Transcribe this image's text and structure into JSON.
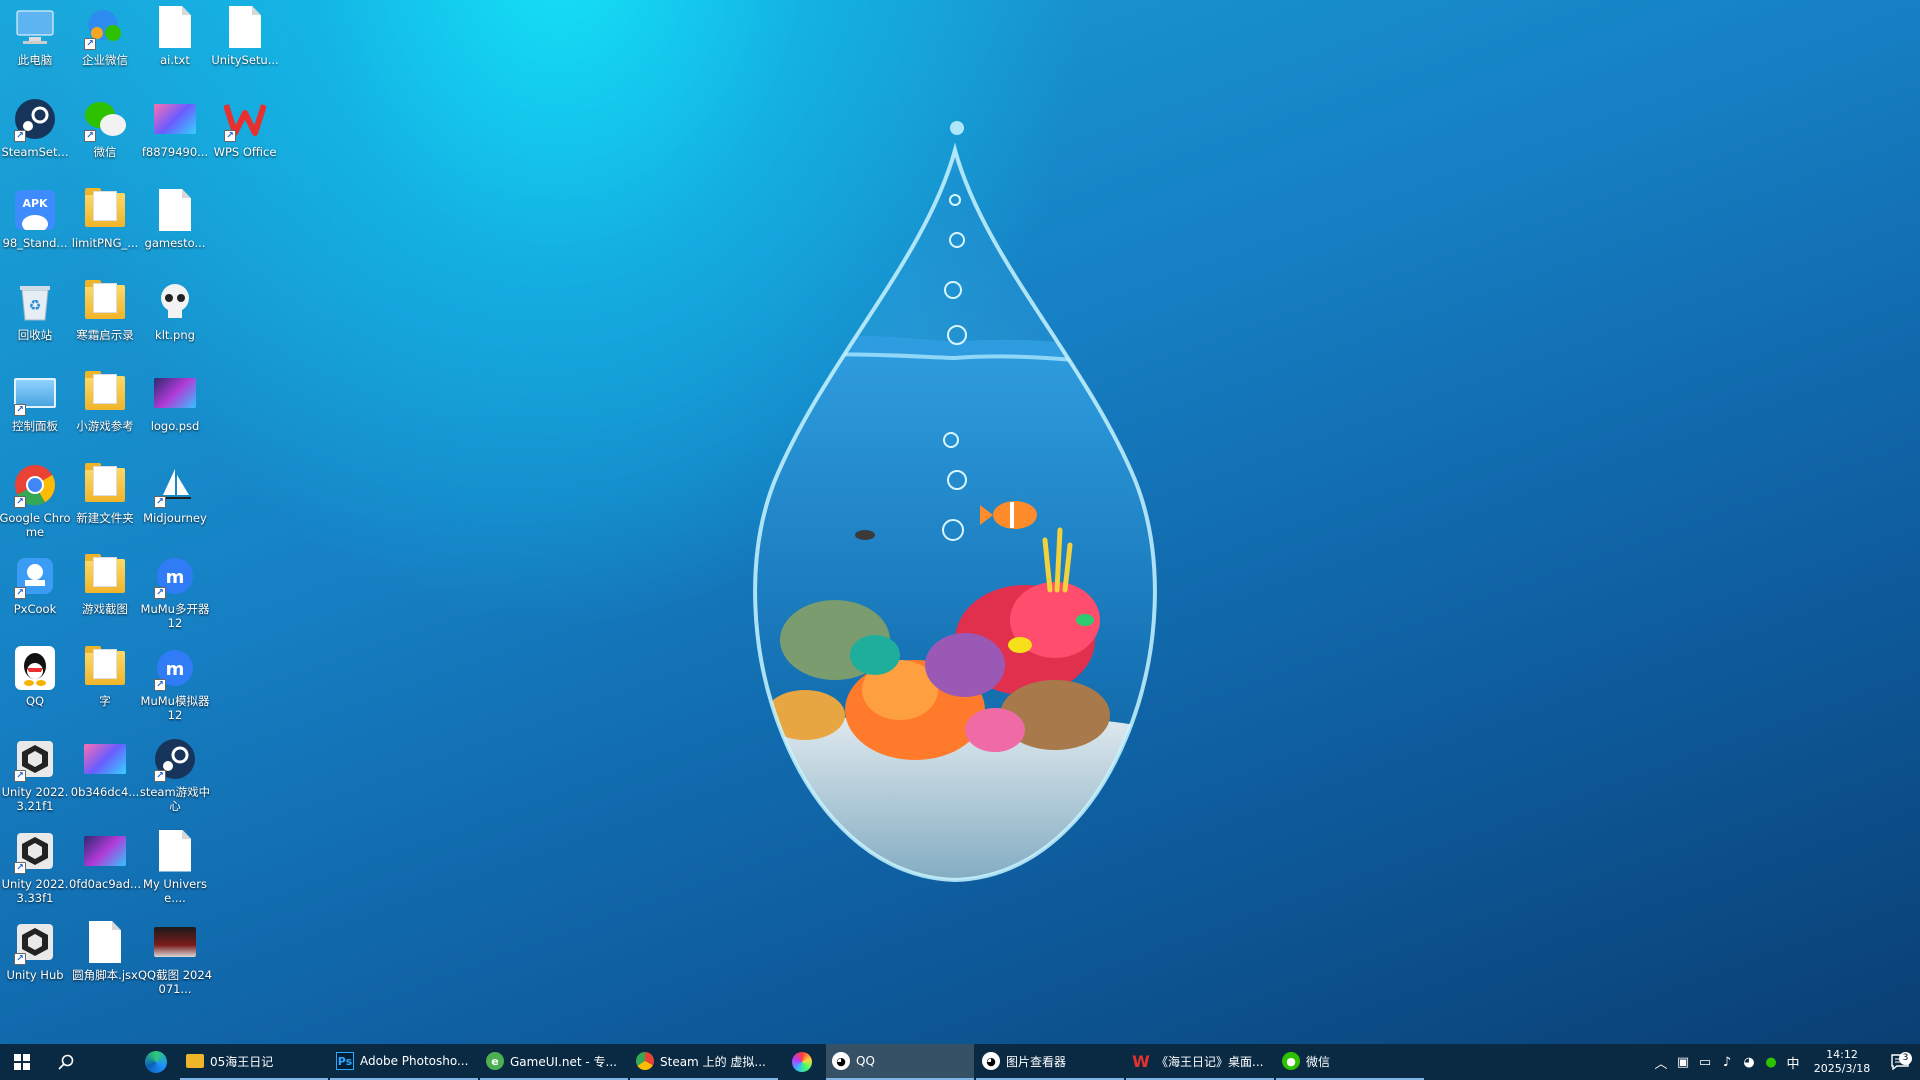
{
  "desktop": {
    "icons": [
      {
        "label": "此电脑",
        "icon": "computer-icon"
      },
      {
        "label": "企业微信",
        "icon": "wecom-icon"
      },
      {
        "label": "ai.txt",
        "icon": "text-file-icon"
      },
      {
        "label": "UnitySetu...",
        "icon": "file-icon"
      },
      {
        "label": "SteamSet...",
        "icon": "steam-icon"
      },
      {
        "label": "微信",
        "icon": "wechat-icon"
      },
      {
        "label": "f8879490...",
        "icon": "image-thumbnail-icon"
      },
      {
        "label": "WPS Office",
        "icon": "wps-icon"
      },
      {
        "label": "98_Stand...",
        "icon": "apk-icon"
      },
      {
        "label": "limitPNG_...",
        "icon": "folder-icon"
      },
      {
        "label": "gamesto...",
        "icon": "file-icon"
      },
      {
        "label": "回收站",
        "icon": "recycle-bin-icon"
      },
      {
        "label": "寒霜启示录",
        "icon": "folder-icon"
      },
      {
        "label": "klt.png",
        "icon": "skull-image-icon"
      },
      {
        "label": "控制面板",
        "icon": "control-panel-icon"
      },
      {
        "label": "小游戏参考",
        "icon": "folder-icon"
      },
      {
        "label": "logo.psd",
        "icon": "psd-thumbnail-icon"
      },
      {
        "label": "Google Chrome",
        "icon": "chrome-icon"
      },
      {
        "label": "新建文件夹",
        "icon": "folder-icon"
      },
      {
        "label": "Midjourney",
        "icon": "midjourney-icon"
      },
      {
        "label": "PxCook",
        "icon": "pxcook-icon"
      },
      {
        "label": "游戏截图",
        "icon": "folder-icon"
      },
      {
        "label": "MuMu多开器12",
        "icon": "mumu-icon"
      },
      {
        "label": "QQ",
        "icon": "qq-icon"
      },
      {
        "label": "字",
        "icon": "folder-icon"
      },
      {
        "label": "MuMu模拟器12",
        "icon": "mumu-icon"
      },
      {
        "label": "Unity 2022.3.21f1",
        "icon": "unity-icon"
      },
      {
        "label": "0b346dc4...",
        "icon": "image-thumbnail-icon"
      },
      {
        "label": "steam游戏中心",
        "icon": "steam-icon"
      },
      {
        "label": "Unity 2022.3.33f1",
        "icon": "unity-icon"
      },
      {
        "label": "0fd0ac9ad...",
        "icon": "psd-thumbnail-icon"
      },
      {
        "label": "My Universe....",
        "icon": "file-icon"
      },
      {
        "label": "Unity Hub",
        "icon": "unity-icon"
      },
      {
        "label": "圆角脚本.jsx",
        "icon": "file-icon"
      },
      {
        "label": "QQ截图 2024071...",
        "icon": "screenshot-thumbnail-icon"
      }
    ]
  },
  "taskbar": {
    "start_icon": "windows-start-icon",
    "search_icon": "search-icon",
    "items": [
      {
        "label": "",
        "icon": "edge-icon"
      },
      {
        "label": "05海王日记",
        "icon": "folder-icon"
      },
      {
        "label": "Adobe Photosho...",
        "icon": "photoshop-icon"
      },
      {
        "label": "GameUI.net - 专...",
        "icon": "browser-icon"
      },
      {
        "label": "Steam 上的 虚拟...",
        "icon": "chrome-icon"
      },
      {
        "label": "",
        "icon": "color-picker-icon"
      },
      {
        "label": "QQ",
        "icon": "qq-icon"
      },
      {
        "label": "图片查看器",
        "icon": "qq-icon"
      },
      {
        "label": "《海王日记》桌面...",
        "icon": "wps-icon"
      },
      {
        "label": "微信",
        "icon": "wechat-icon"
      }
    ],
    "tray": {
      "time": "14:12",
      "date": "2025/3/18",
      "ime": "中",
      "notification_count": "3"
    }
  }
}
